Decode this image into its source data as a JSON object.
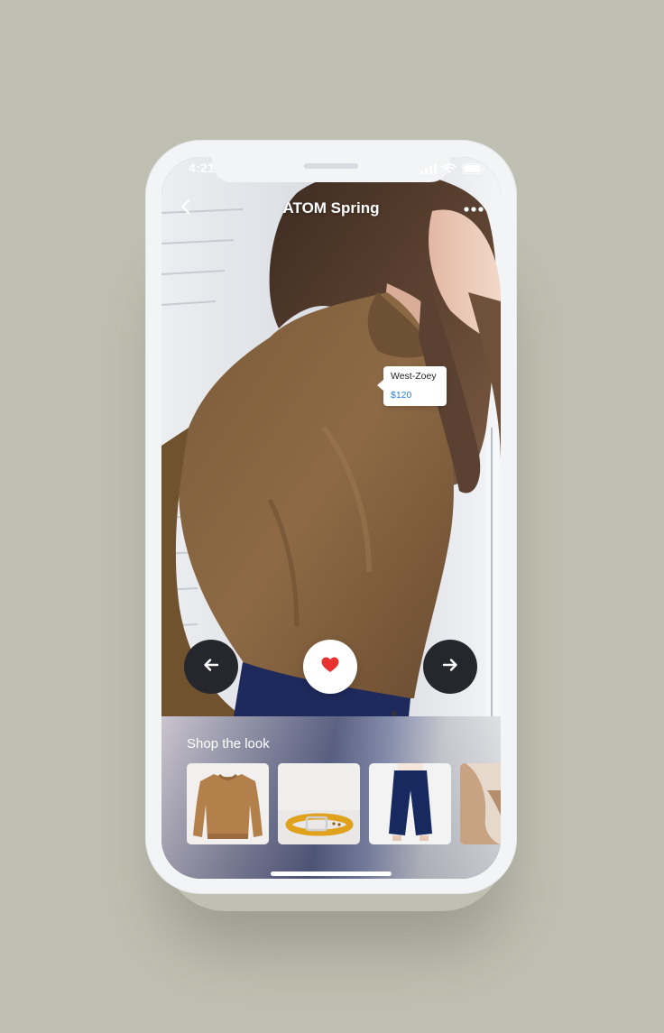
{
  "status_bar": {
    "time": "4:21",
    "icons": [
      "cellular-signal-icon",
      "wifi-icon",
      "battery-icon"
    ]
  },
  "nav": {
    "title": "ATOM Spring",
    "back_icon": "chevron-left-icon",
    "more_icon": "more-dots-icon"
  },
  "product_tag": {
    "name": "West-Zoey",
    "price": "$120"
  },
  "actions": {
    "prev_icon": "arrow-left-icon",
    "like_icon": "heart-icon",
    "next_icon": "arrow-right-icon",
    "like_color": "#e8302f"
  },
  "shop": {
    "title": "Shop the look",
    "items": [
      {
        "product": "brown-sweater"
      },
      {
        "product": "yellow-belt"
      },
      {
        "product": "navy-culottes"
      },
      {
        "product": "tan-top"
      }
    ]
  },
  "colors": {
    "background": "#c0c0b2",
    "phone_frame": "#f3f4f6",
    "dark_button": "#26272c",
    "price_link": "#2a7fd4"
  }
}
